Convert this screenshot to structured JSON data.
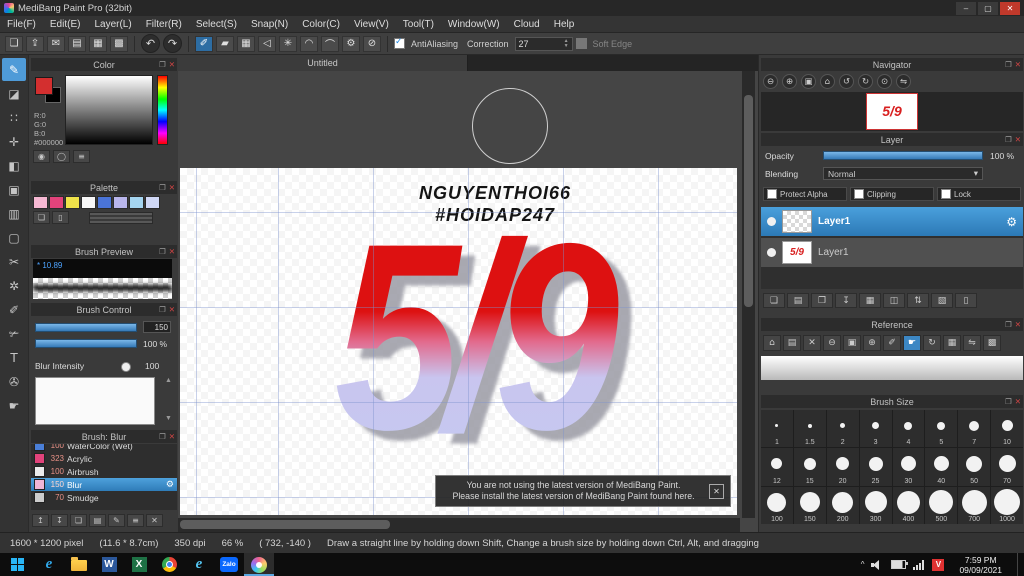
{
  "glyphs": {
    "popout": "❐",
    "close": "✕",
    "check": "✓",
    "down": "▾",
    "gear": "⚙",
    "up_arrow": "▲",
    "down_arrow": "▼"
  },
  "window": {
    "title": "MediBang Paint Pro (32bit)",
    "controls": [
      {
        "name": "minimize",
        "glyph": "–"
      },
      {
        "name": "maximize",
        "glyph": "▢"
      },
      {
        "name": "close",
        "glyph": "✕"
      }
    ]
  },
  "menu": {
    "items": [
      "File(F)",
      "Edit(E)",
      "Layer(L)",
      "Filter(R)",
      "Select(S)",
      "Snap(N)",
      "Color(C)",
      "View(V)",
      "Tool(T)",
      "Window(W)",
      "Cloud",
      "Help"
    ]
  },
  "toolbar": {
    "file_icons": [
      {
        "name": "window",
        "glyph": "❏"
      },
      {
        "name": "upload",
        "glyph": "⇪"
      },
      {
        "name": "comment",
        "glyph": "✉"
      },
      {
        "name": "palette",
        "glyph": "▤"
      },
      {
        "name": "pixel-grid",
        "glyph": "▦"
      },
      {
        "name": "material",
        "glyph": "▩"
      }
    ],
    "undo_glyph": "↶",
    "redo_glyph": "↷",
    "snap_icons": [
      {
        "name": "snap-pen",
        "glyph": "✐",
        "active": true
      },
      {
        "name": "snap-parallel",
        "glyph": "▰"
      },
      {
        "name": "snap-grid",
        "glyph": "▦"
      },
      {
        "name": "snap-angle",
        "glyph": "◁"
      },
      {
        "name": "snap-radial",
        "glyph": "✳"
      },
      {
        "name": "snap-circle",
        "glyph": "◠"
      },
      {
        "name": "snap-curve",
        "glyph": "⌒"
      },
      {
        "name": "snap-settings",
        "glyph": "⚙"
      },
      {
        "name": "snap-off",
        "glyph": "⊘"
      }
    ],
    "antialiasing_label": "AntiAliasing",
    "correction_label": "Correction",
    "correction_value": "27",
    "soft_edge_label": "Soft Edge"
  },
  "tools": [
    {
      "name": "brush",
      "glyph": "✎",
      "active": true
    },
    {
      "name": "eraser",
      "glyph": "◪"
    },
    {
      "name": "dot",
      "glyph": "∷"
    },
    {
      "name": "move",
      "glyph": "✛"
    },
    {
      "name": "fill",
      "glyph": "◧"
    },
    {
      "name": "bucket",
      "glyph": "▣"
    },
    {
      "name": "gradient",
      "glyph": "▥"
    },
    {
      "name": "select",
      "glyph": "▢"
    },
    {
      "name": "lasso",
      "glyph": "✂"
    },
    {
      "name": "magic-wand",
      "glyph": "✲"
    },
    {
      "name": "select-pen",
      "glyph": "✐"
    },
    {
      "name": "select-eraser",
      "glyph": "✃"
    },
    {
      "name": "text",
      "glyph": "T"
    },
    {
      "name": "eyedropper",
      "glyph": "✇"
    },
    {
      "name": "hand",
      "glyph": "☛"
    }
  ],
  "color_panel": {
    "title": "Color",
    "r": "R:0",
    "g": "G:0",
    "b": "B:0",
    "hex": "#000000",
    "icons": [
      {
        "name": "foreground-color",
        "glyph": "◉"
      },
      {
        "name": "transparent-color",
        "glyph": "◯"
      },
      {
        "name": "slider-mode",
        "glyph": "≡"
      }
    ]
  },
  "palette_panel": {
    "title": "Palette",
    "swatches": [
      "#f6b8d3",
      "#e2437b",
      "#efe24a",
      "#f7f7f7",
      "#4a74d8",
      "#b9b6ec",
      "#a5d5f0",
      "#d0d8f6"
    ],
    "buttons": [
      {
        "name": "add-color",
        "glyph": "❏"
      },
      {
        "name": "delete-color",
        "glyph": "▯"
      }
    ]
  },
  "brush_preview_panel": {
    "title": "Brush Preview",
    "value": "* 10.89"
  },
  "brush_control_panel": {
    "title": "Brush Control",
    "size_value": "150",
    "opacity_value": "100 %",
    "blur_label": "Blur Intensity",
    "blur_value": "100"
  },
  "brush_list_panel": {
    "title": "Brush: Blur",
    "items": [
      {
        "size": "100",
        "name": "WaterColor (Wet)",
        "swatch": "#4a7fd8"
      },
      {
        "size": "323",
        "name": "Acrylic",
        "swatch": "#e2437b"
      },
      {
        "size": "100",
        "name": "Airbrush",
        "swatch": "#ececec"
      },
      {
        "size": "150",
        "name": "Blur",
        "swatch": "#f0b6d6",
        "selected": true
      },
      {
        "size": "70",
        "name": "Smudge",
        "swatch": "#cccccc"
      }
    ],
    "footer_icons": [
      {
        "name": "brush-up",
        "glyph": "↥"
      },
      {
        "name": "brush-down",
        "glyph": "↧"
      },
      {
        "name": "add-brush",
        "glyph": "❏"
      },
      {
        "name": "brush-folder",
        "glyph": "▤"
      },
      {
        "name": "edit-brush",
        "glyph": "✎"
      },
      {
        "name": "brush-menu",
        "glyph": "≡"
      },
      {
        "name": "delete-brush",
        "glyph": "✕"
      }
    ]
  },
  "canvas": {
    "tab": "Untitled",
    "line1": "NGUYENTHOI66",
    "line2": "#HOIDAP247",
    "art": "5/9",
    "notice1": "You are not using the latest version of MediBang Paint.",
    "notice2": "Please install the latest version of MediBang Paint found here.",
    "colors": {
      "art_top": "#dd1111",
      "art_bottom": "#c9c5ef",
      "art_shadow": "#9b9ba5",
      "grid": "#7d91cd"
    }
  },
  "navigator_panel": {
    "title": "Navigator",
    "thumb_text": "5/9",
    "buttons": [
      {
        "name": "zoom-out",
        "glyph": "⊖"
      },
      {
        "name": "zoom-in",
        "glyph": "⊕"
      },
      {
        "name": "fit-canvas",
        "glyph": "▣"
      },
      {
        "name": "actual-size",
        "glyph": "⌂"
      },
      {
        "name": "rotate-left",
        "glyph": "↺"
      },
      {
        "name": "rotate-right",
        "glyph": "↻"
      },
      {
        "name": "reset-view",
        "glyph": "⊙"
      },
      {
        "name": "flip-horizontal",
        "glyph": "⇋"
      }
    ]
  },
  "layer_panel": {
    "title": "Layer",
    "opacity_label": "Opacity",
    "opacity_value": "100 %",
    "blending_label": "Blending",
    "blending_value": "Normal",
    "toggles": [
      "Protect Alpha",
      "Clipping",
      "Lock"
    ],
    "layers": [
      {
        "name": "Layer1",
        "selected": true,
        "thumb": ""
      },
      {
        "name": "Layer1",
        "selected": false,
        "thumb": "5/9"
      }
    ],
    "footer_icons": [
      {
        "name": "new-layer",
        "glyph": "❏"
      },
      {
        "name": "new-folder",
        "glyph": "▤"
      },
      {
        "name": "duplicate-layer",
        "glyph": "❐"
      },
      {
        "name": "merge-down",
        "glyph": "↧"
      },
      {
        "name": "rasterize",
        "glyph": "▦"
      },
      {
        "name": "layer-mask",
        "glyph": "◫"
      },
      {
        "name": "reorder-layers",
        "glyph": "⇅"
      },
      {
        "name": "convert-layer",
        "glyph": "▧"
      },
      {
        "name": "delete-layer",
        "glyph": "▯"
      }
    ]
  },
  "reference_panel": {
    "title": "Reference",
    "buttons": [
      {
        "name": "ref-home",
        "glyph": "⌂"
      },
      {
        "name": "ref-open",
        "glyph": "▤"
      },
      {
        "name": "ref-close",
        "glyph": "✕"
      },
      {
        "name": "ref-zoom-out",
        "glyph": "⊖"
      },
      {
        "name": "ref-fit",
        "glyph": "▣"
      },
      {
        "name": "ref-zoom-in",
        "glyph": "⊕"
      },
      {
        "name": "ref-eyedropper",
        "glyph": "✐"
      },
      {
        "name": "ref-hand",
        "glyph": "☛",
        "active": true
      },
      {
        "name": "ref-rotate",
        "glyph": "↻"
      },
      {
        "name": "ref-grid",
        "glyph": "▦"
      },
      {
        "name": "ref-flip",
        "glyph": "⇋"
      },
      {
        "name": "ref-lock",
        "glyph": "▩"
      }
    ]
  },
  "brush_size_panel": {
    "title": "Brush Size",
    "values": [
      "1",
      "1.5",
      "2",
      "3",
      "4",
      "5",
      "7",
      "10",
      "12",
      "15",
      "20",
      "25",
      "30",
      "40",
      "50",
      "70",
      "100",
      "150",
      "200",
      "300",
      "400",
      "500",
      "700",
      "1000"
    ]
  },
  "statusbar": {
    "size": "1600 * 1200 pixel",
    "cm": "(11.6 * 8.7cm)",
    "dpi": "350 dpi",
    "zoom": "66 %",
    "coords": "( 732, -140 )",
    "hint": "Draw a straight line by holding down Shift, Change a brush size by holding down Ctrl, Alt, and dragging"
  },
  "taskbar": {
    "apps": [
      {
        "name": "edge",
        "label": "e"
      },
      {
        "name": "explorer",
        "label": ""
      },
      {
        "name": "word",
        "label": "W"
      },
      {
        "name": "excel",
        "label": "X"
      },
      {
        "name": "chrome",
        "label": ""
      },
      {
        "name": "ie",
        "label": "e"
      },
      {
        "name": "zalo",
        "label": "Zalo"
      },
      {
        "name": "medibang",
        "label": "",
        "active": true
      }
    ],
    "tray_icons": [
      {
        "name": "tray-expand",
        "glyph": "^"
      },
      {
        "name": "volume",
        "glyph": ""
      },
      {
        "name": "battery",
        "glyph": ""
      },
      {
        "name": "network",
        "glyph": ""
      },
      {
        "name": "unikey",
        "glyph": "V"
      }
    ],
    "time": "7:59 PM",
    "date": "09/09/2021"
  }
}
